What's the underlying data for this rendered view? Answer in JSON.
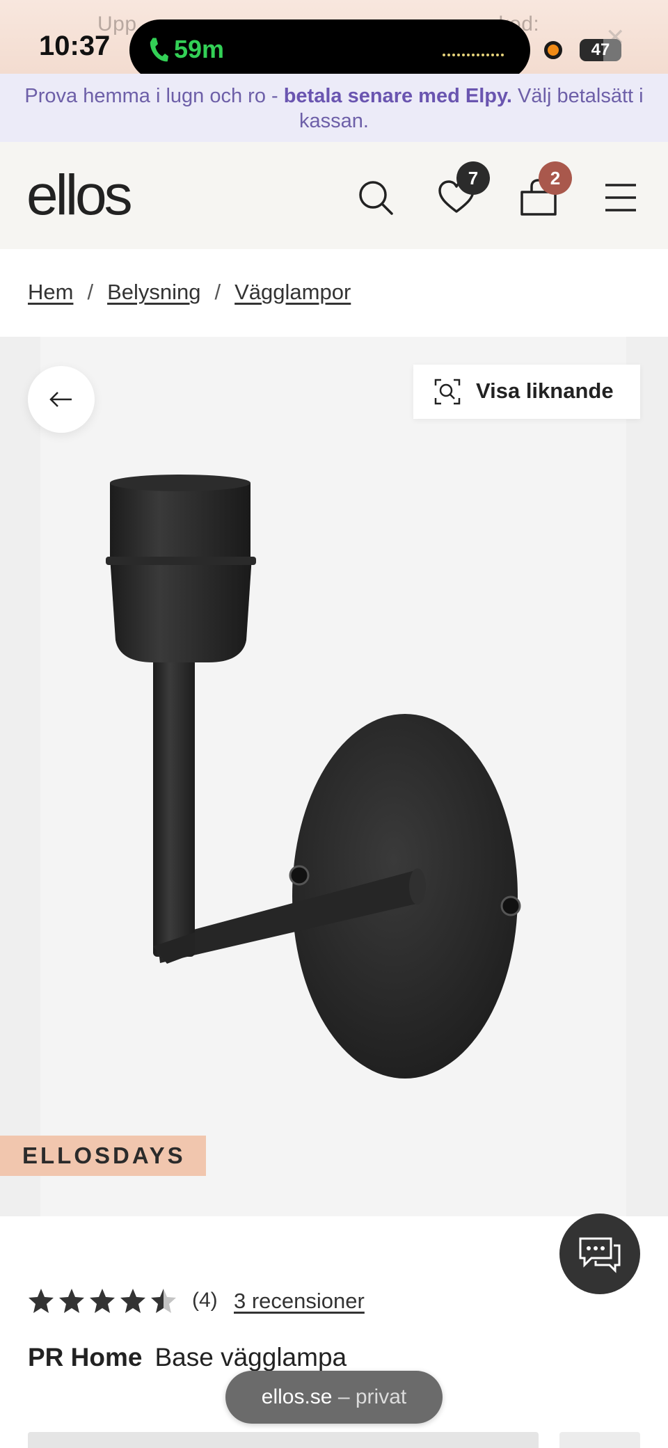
{
  "status_bar": {
    "time": "10:37",
    "call_duration": "59m",
    "battery": "47"
  },
  "promo_top": {
    "ghost_text_left": "Upp",
    "ghost_text_right": "kod:"
  },
  "promo_bar": {
    "text_plain": "Prova hemma i lugn och ro - ",
    "text_bold": "betala senare med Elpy.",
    "text_after": " Välj betalsätt i kassan."
  },
  "header": {
    "logo": "ellos",
    "wishlist_count": "7",
    "cart_count": "2",
    "colors": {
      "wishlist_badge": "#2b2b2b",
      "cart_badge": "#a9584c"
    }
  },
  "breadcrumb": {
    "items": [
      "Hem",
      "Belysning",
      "Vägglampor"
    ],
    "separator": "/"
  },
  "product_media": {
    "similar_label": "Visa liknande",
    "tag": "ELLOSDAYS"
  },
  "rating": {
    "stars": 4.5,
    "count": "(4)",
    "reviews": "3 recensioner"
  },
  "product": {
    "brand": "PR Home",
    "name": "Base vägglampa"
  },
  "browser": {
    "domain": "ellos.se",
    "mode": "– privat"
  },
  "icons": [
    "phone-icon",
    "search-icon",
    "heart-icon",
    "bag-icon",
    "menu-icon",
    "arrow-left-icon",
    "visual-search-icon",
    "chat-icon",
    "star-icon",
    "close-icon"
  ]
}
